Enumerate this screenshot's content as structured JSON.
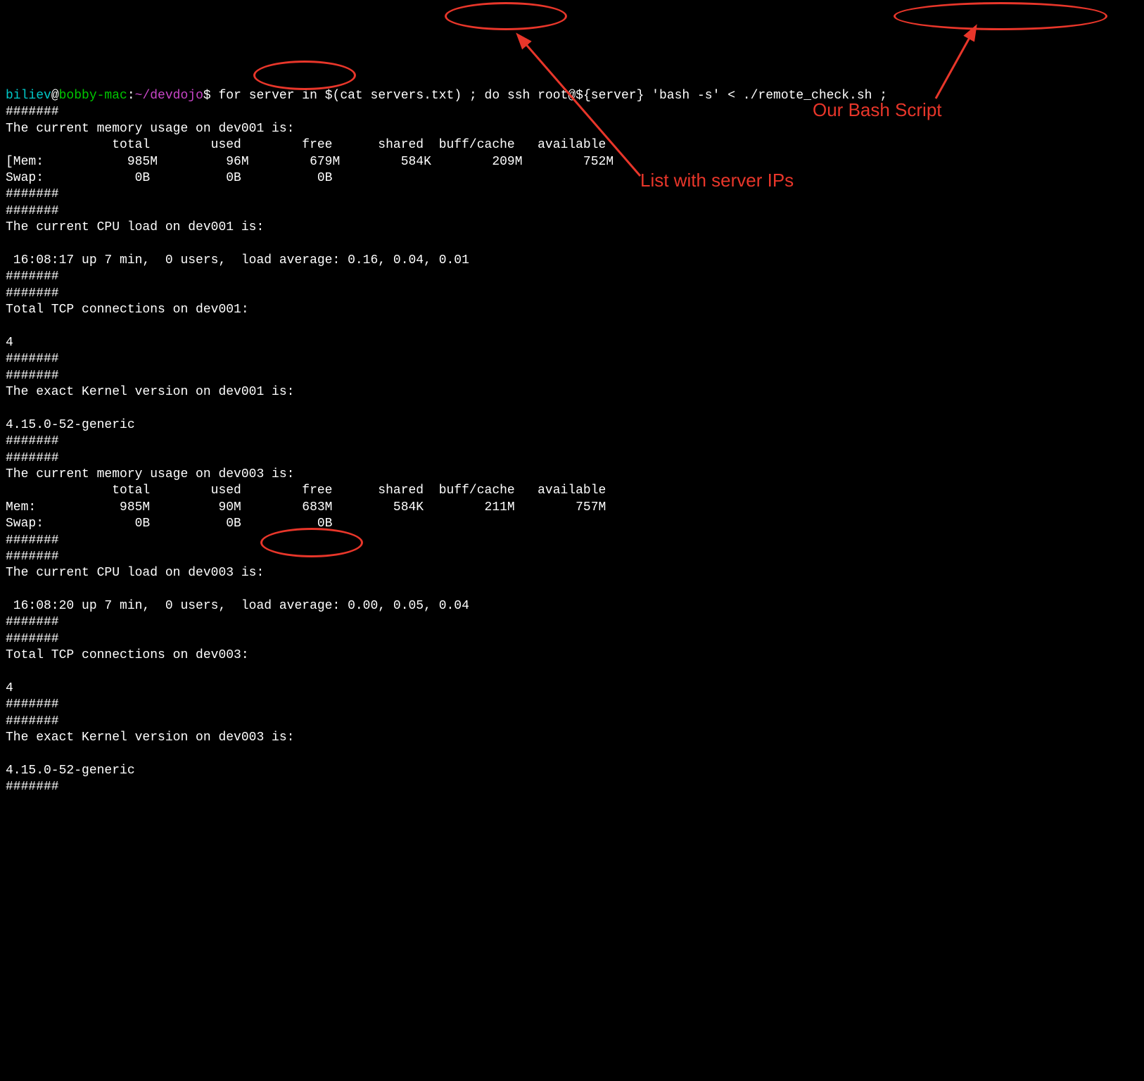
{
  "prompt": {
    "user": "biliev",
    "at": "@",
    "host": "bobby-mac",
    "colon": ":",
    "path": "~/devdojo",
    "dollar": "$ "
  },
  "command": "for server in $(cat servers.txt) ; do ssh root@${server} 'bash -s' < ./remote_check.sh ;",
  "annotations": {
    "server_ips": "List with server IPs",
    "bash_script": "Our Bash Script"
  },
  "servers": [
    {
      "name": "dev001",
      "memory": {
        "title": "The current memory usage on dev001 is:",
        "header": "              total        used        free      shared  buff/cache   available",
        "mem": "[Mem:           985M         96M        679M        584K        209M        752M",
        "swap": "Swap:            0B          0B          0B"
      },
      "cpu": {
        "title": "The current CPU load on dev001 is:",
        "line": " 16:08:17 up 7 min,  0 users,  load average: 0.16, 0.04, 0.01"
      },
      "tcp": {
        "title": "Total TCP connections on dev001:",
        "value": "4"
      },
      "kernel": {
        "title": "The exact Kernel version on dev001 is:",
        "value": "4.15.0-52-generic"
      }
    },
    {
      "name": "dev003",
      "memory": {
        "title": "The current memory usage on dev003 is:",
        "header": "              total        used        free      shared  buff/cache   available",
        "mem": "Mem:           985M         90M        683M        584K        211M        757M",
        "swap": "Swap:            0B          0B          0B"
      },
      "cpu": {
        "title": "The current CPU load on dev003 is:",
        "line": " 16:08:20 up 7 min,  0 users,  load average: 0.00, 0.05, 0.04"
      },
      "tcp": {
        "title": "Total TCP connections on dev003:",
        "value": "4"
      },
      "kernel": {
        "title": "The exact Kernel version on dev003 is:",
        "value": "4.15.0-52-generic"
      }
    }
  ],
  "hash": "#######"
}
